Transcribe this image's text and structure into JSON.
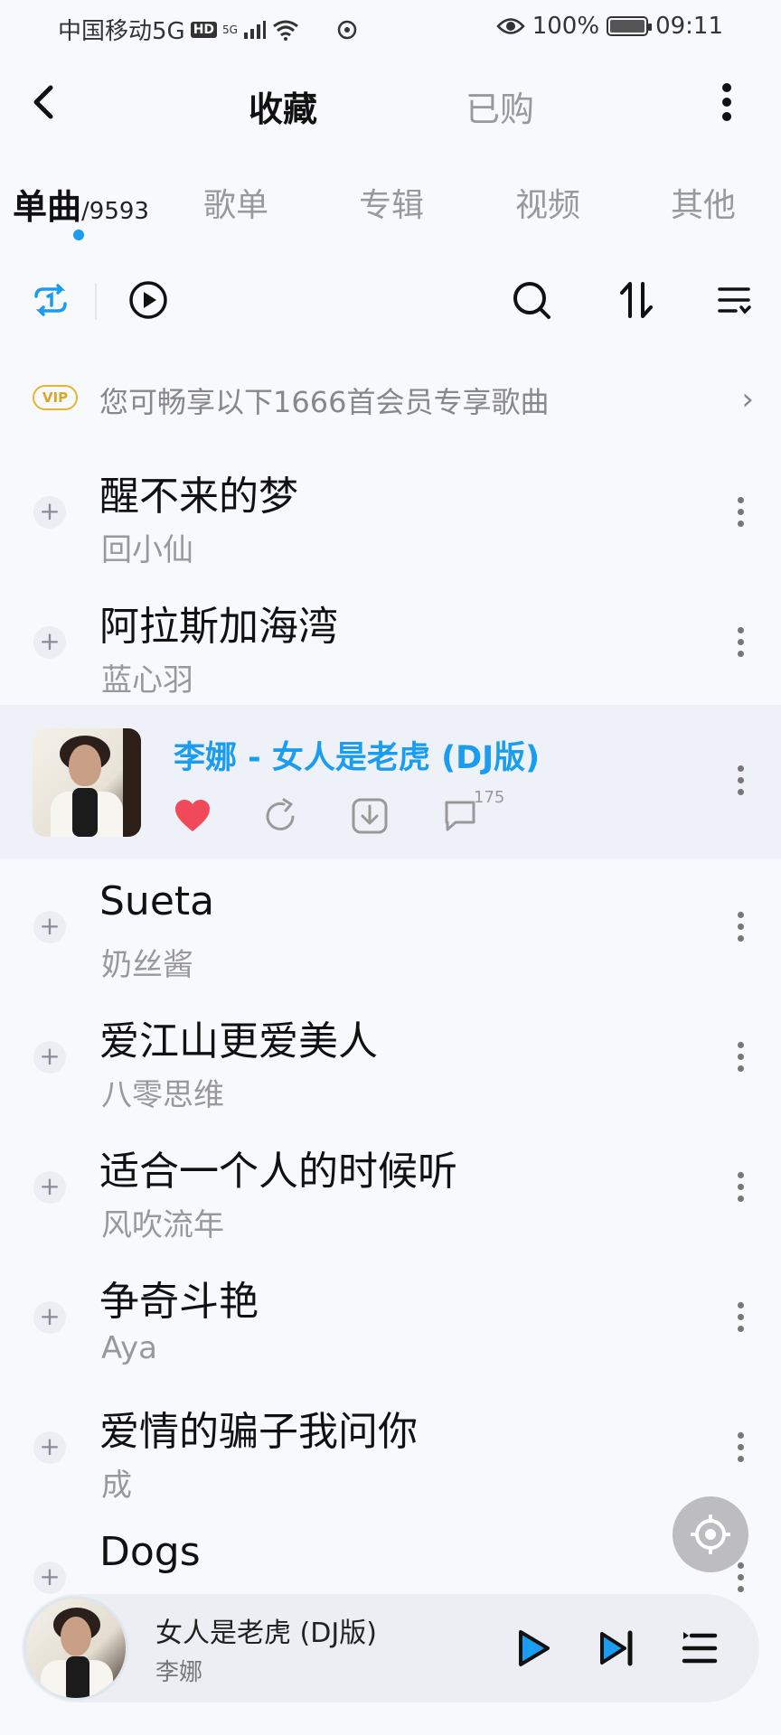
{
  "status_bar": {
    "carrier": "中国移动5G",
    "hd": "HD",
    "net": "5G",
    "battery": "100%",
    "battery_level": 1.0,
    "time": "09:11"
  },
  "header": {
    "tab_favorites": "收藏",
    "tab_purchased": "已购"
  },
  "subtabs": {
    "singles": "单曲",
    "singles_count": "/9593",
    "playlists": "歌单",
    "albums": "专辑",
    "videos": "视频",
    "others": "其他"
  },
  "vip": {
    "badge": "VIP",
    "text": "您可畅享以下1666首会员专享歌曲",
    "arrow": "›"
  },
  "songs": [
    {
      "title": "醒不来的梦",
      "artist": "回小仙"
    },
    {
      "title": "阿拉斯加海湾",
      "artist": "蓝心羽"
    },
    {
      "title": "Sueta",
      "artist": "奶丝酱"
    },
    {
      "title": "爱江山更爱美人",
      "artist": "八零思维"
    },
    {
      "title": "适合一个人的时候听",
      "artist": "风吹流年"
    },
    {
      "title": "争奇斗艳",
      "artist": "Aya"
    },
    {
      "title": "爱情的骗子我问你",
      "artist": "成"
    },
    {
      "title": "Dogs",
      "artist": ""
    }
  ],
  "now_playing_row": {
    "title": "李娜 - 女人是老虎 (DJ版)",
    "comment_count": "175",
    "accent": "#1a9df0",
    "heart_color": "#f04a5a"
  },
  "mini_player": {
    "title": "女人是老虎 (DJ版)",
    "artist": "李娜"
  },
  "icons": {
    "back": "chevron-left-icon",
    "more": "more-vertical-icon",
    "loop": "repeat-one-icon",
    "play_all": "play-circle-icon",
    "search": "search-icon",
    "sort": "sort-icon",
    "manage": "list-manage-icon"
  }
}
